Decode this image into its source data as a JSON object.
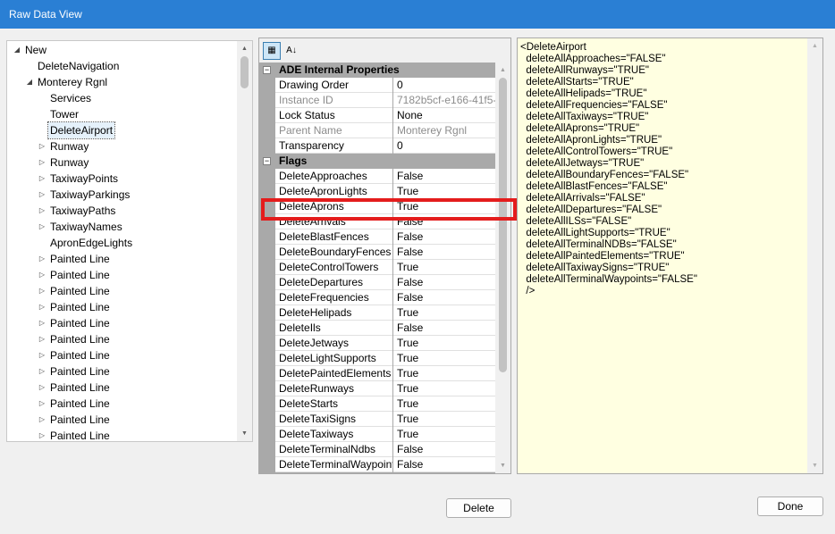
{
  "window": {
    "title": "Raw Data View"
  },
  "tree": {
    "items": [
      {
        "label": "New",
        "expander": "◢"
      },
      {
        "label": "DeleteNavigation",
        "expander": ""
      },
      {
        "label": "Monterey Rgnl",
        "expander": "◢"
      },
      {
        "label": "Services",
        "expander": ""
      },
      {
        "label": "Tower",
        "expander": ""
      },
      {
        "label": "DeleteAirport",
        "expander": ""
      },
      {
        "label": "Runway",
        "expander": "▷"
      },
      {
        "label": "Runway",
        "expander": "▷"
      },
      {
        "label": "TaxiwayPoints",
        "expander": "▷"
      },
      {
        "label": "TaxiwayParkings",
        "expander": "▷"
      },
      {
        "label": "TaxiwayPaths",
        "expander": "▷"
      },
      {
        "label": "TaxiwayNames",
        "expander": "▷"
      },
      {
        "label": "ApronEdgeLights",
        "expander": ""
      },
      {
        "label": "Painted Line",
        "expander": "▷"
      },
      {
        "label": "Painted Line",
        "expander": "▷"
      },
      {
        "label": "Painted Line",
        "expander": "▷"
      },
      {
        "label": "Painted Line",
        "expander": "▷"
      },
      {
        "label": "Painted Line",
        "expander": "▷"
      },
      {
        "label": "Painted Line",
        "expander": "▷"
      },
      {
        "label": "Painted Line",
        "expander": "▷"
      },
      {
        "label": "Painted Line",
        "expander": "▷"
      },
      {
        "label": "Painted Line",
        "expander": "▷"
      },
      {
        "label": "Painted Line",
        "expander": "▷"
      },
      {
        "label": "Painted Line",
        "expander": "▷"
      },
      {
        "label": "Painted Line",
        "expander": "▷"
      }
    ]
  },
  "propertygrid": {
    "toolbar": {
      "categorized_icon": "▦",
      "alphabetical_icon": "A↓"
    },
    "categories": [
      {
        "label": "ADE Internal Properties",
        "toggle": "−",
        "props": [
          {
            "name": "Drawing Order",
            "value": "0",
            "readonly": false
          },
          {
            "name": "Instance ID",
            "value": "7182b5cf-e166-41f5-...",
            "readonly": true
          },
          {
            "name": "Lock Status",
            "value": "None",
            "readonly": false
          },
          {
            "name": "Parent Name",
            "value": "Monterey Rgnl",
            "readonly": true
          },
          {
            "name": "Transparency",
            "value": "0",
            "readonly": false
          }
        ]
      },
      {
        "label": "Flags",
        "toggle": "−",
        "props": [
          {
            "name": "DeleteApproaches",
            "value": "False",
            "readonly": false
          },
          {
            "name": "DeleteApronLights",
            "value": "True",
            "readonly": false
          },
          {
            "name": "DeleteAprons",
            "value": "True",
            "readonly": false
          },
          {
            "name": "DeleteArrivals",
            "value": "False",
            "readonly": false
          },
          {
            "name": "DeleteBlastFences",
            "value": "False",
            "readonly": false
          },
          {
            "name": "DeleteBoundaryFences",
            "value": "False",
            "readonly": false
          },
          {
            "name": "DeleteControlTowers",
            "value": "True",
            "readonly": false
          },
          {
            "name": "DeleteDepartures",
            "value": "False",
            "readonly": false
          },
          {
            "name": "DeleteFrequencies",
            "value": "False",
            "readonly": false
          },
          {
            "name": "DeleteHelipads",
            "value": "True",
            "readonly": false
          },
          {
            "name": "DeleteIls",
            "value": "False",
            "readonly": false
          },
          {
            "name": "DeleteJetways",
            "value": "True",
            "readonly": false
          },
          {
            "name": "DeleteLightSupports",
            "value": "True",
            "readonly": false
          },
          {
            "name": "DeletePaintedElements",
            "value": "True",
            "readonly": false
          },
          {
            "name": "DeleteRunways",
            "value": "True",
            "readonly": false
          },
          {
            "name": "DeleteStarts",
            "value": "True",
            "readonly": false
          },
          {
            "name": "DeleteTaxiSigns",
            "value": "True",
            "readonly": false
          },
          {
            "name": "DeleteTaxiways",
            "value": "True",
            "readonly": false
          },
          {
            "name": "DeleteTerminalNdbs",
            "value": "False",
            "readonly": false
          },
          {
            "name": "DeleteTerminalWaypoints",
            "value": "False",
            "readonly": false
          }
        ]
      }
    ]
  },
  "xml": {
    "lines": [
      "<DeleteAirport",
      "  deleteAllApproaches=\"FALSE\"",
      "  deleteAllRunways=\"TRUE\"",
      "  deleteAllStarts=\"TRUE\"",
      "  deleteAllHelipads=\"TRUE\"",
      "  deleteAllFrequencies=\"FALSE\"",
      "  deleteAllTaxiways=\"TRUE\"",
      "  deleteAllAprons=\"TRUE\"",
      "  deleteAllApronLights=\"TRUE\"",
      "  deleteAllControlTowers=\"TRUE\"",
      "  deleteAllJetways=\"TRUE\"",
      "  deleteAllBoundaryFences=\"FALSE\"",
      "  deleteAllBlastFences=\"FALSE\"",
      "  deleteAllArrivals=\"FALSE\"",
      "  deleteAllDepartures=\"FALSE\"",
      "  deleteAllILSs=\"FALSE\"",
      "  deleteAllLightSupports=\"TRUE\"",
      "  deleteAllTerminalNDBs=\"FALSE\"",
      "  deleteAllPaintedElements=\"TRUE\"",
      "  deleteAllTaxiwaySigns=\"TRUE\"",
      "  deleteAllTerminalWaypoints=\"FALSE\"",
      "  />"
    ]
  },
  "buttons": {
    "delete_label": "Delete",
    "done_label": "Done"
  },
  "scroll_glyphs": {
    "up": "▲",
    "down": "▼"
  },
  "colors": {
    "titlebar": "#2a7fd4",
    "highlight": "#e41c1c",
    "xml_background": "#ffffe1"
  }
}
